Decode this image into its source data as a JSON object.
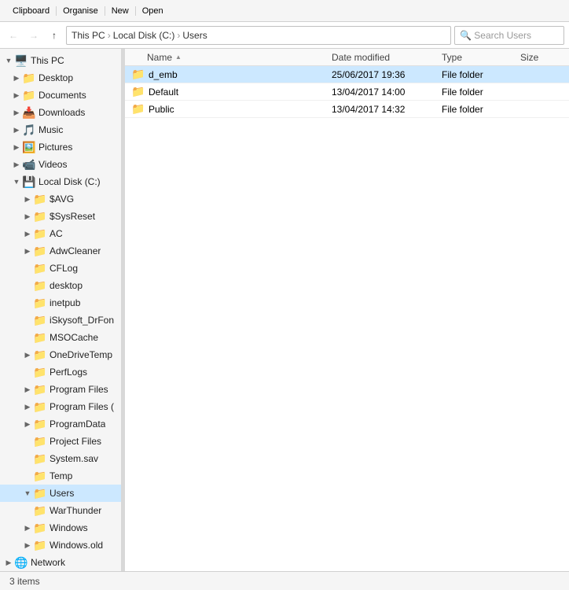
{
  "toolbar": {
    "sections": [
      {
        "label": "Clipboard"
      },
      {
        "label": "Organise"
      },
      {
        "label": "New"
      },
      {
        "label": "Open"
      }
    ],
    "clipboard_label": "Clipboard",
    "organise_label": "Organise",
    "new_label": "New",
    "open_label": "Open"
  },
  "addressbar": {
    "back_label": "←",
    "forward_label": "→",
    "up_label": "↑",
    "breadcrumbs": [
      "This PC",
      "Local Disk (C:)",
      "Users"
    ],
    "search_placeholder": "Search Users"
  },
  "sidebar": {
    "items": [
      {
        "id": "this-pc",
        "label": "This PC",
        "icon": "🖥️",
        "indent": 0,
        "expanded": true,
        "expander": "▼"
      },
      {
        "id": "desktop",
        "label": "Desktop",
        "icon": "📁",
        "indent": 1,
        "expanded": false,
        "expander": "▶",
        "special": true
      },
      {
        "id": "documents",
        "label": "Documents",
        "icon": "📁",
        "indent": 1,
        "expanded": false,
        "expander": "▶",
        "special": true
      },
      {
        "id": "downloads",
        "label": "Downloads",
        "icon": "📁",
        "indent": 1,
        "expanded": false,
        "expander": "▶",
        "special": true,
        "highlight": true
      },
      {
        "id": "music",
        "label": "Music",
        "icon": "📁",
        "indent": 1,
        "expanded": false,
        "expander": "▶",
        "special": true
      },
      {
        "id": "pictures",
        "label": "Pictures",
        "icon": "📁",
        "indent": 1,
        "expanded": false,
        "expander": "▶",
        "special": true
      },
      {
        "id": "videos",
        "label": "Videos",
        "icon": "📁",
        "indent": 1,
        "expanded": false,
        "expander": "▶",
        "special": true
      },
      {
        "id": "local-disk-c",
        "label": "Local Disk (C:)",
        "icon": "💾",
        "indent": 1,
        "expanded": true,
        "expander": "▼"
      },
      {
        "id": "savg",
        "label": "$AVG",
        "icon": "📁",
        "indent": 2,
        "expanded": false,
        "expander": "▶"
      },
      {
        "id": "ssysreset",
        "label": "$SysReset",
        "icon": "📁",
        "indent": 2,
        "expanded": false,
        "expander": "▶"
      },
      {
        "id": "ac",
        "label": "AC",
        "icon": "📁",
        "indent": 2,
        "expanded": false,
        "expander": "▶"
      },
      {
        "id": "adwcleaner",
        "label": "AdwCleaner",
        "icon": "📁",
        "indent": 2,
        "expanded": false,
        "expander": "▶"
      },
      {
        "id": "cflog",
        "label": "CFLog",
        "icon": "📁",
        "indent": 2,
        "expanded": false,
        "expander": ""
      },
      {
        "id": "desktop2",
        "label": "desktop",
        "icon": "📁",
        "indent": 2,
        "expanded": false,
        "expander": ""
      },
      {
        "id": "inetpub",
        "label": "inetpub",
        "icon": "📁",
        "indent": 2,
        "expanded": false,
        "expander": ""
      },
      {
        "id": "iskysoft",
        "label": "iSkysoft_DrFon",
        "icon": "📁",
        "indent": 2,
        "expanded": false,
        "expander": ""
      },
      {
        "id": "msocache",
        "label": "MSOCache",
        "icon": "📁",
        "indent": 2,
        "expanded": false,
        "expander": ""
      },
      {
        "id": "onedrivetemp",
        "label": "OneDriveTemp",
        "icon": "📁",
        "indent": 2,
        "expanded": false,
        "expander": "▶"
      },
      {
        "id": "perflogs",
        "label": "PerfLogs",
        "icon": "📁",
        "indent": 2,
        "expanded": false,
        "expander": ""
      },
      {
        "id": "program-files",
        "label": "Program Files",
        "icon": "📁",
        "indent": 2,
        "expanded": false,
        "expander": "▶"
      },
      {
        "id": "program-files-x86",
        "label": "Program Files (",
        "icon": "📁",
        "indent": 2,
        "expanded": false,
        "expander": "▶"
      },
      {
        "id": "programdata",
        "label": "ProgramData",
        "icon": "📁",
        "indent": 2,
        "expanded": false,
        "expander": "▶"
      },
      {
        "id": "project-files",
        "label": "Project Files",
        "icon": "📁",
        "indent": 2,
        "expanded": false,
        "expander": ""
      },
      {
        "id": "system-sav",
        "label": "System.sav",
        "icon": "📁",
        "indent": 2,
        "expanded": false,
        "expander": ""
      },
      {
        "id": "temp",
        "label": "Temp",
        "icon": "📁",
        "indent": 2,
        "expanded": false,
        "expander": ""
      },
      {
        "id": "users",
        "label": "Users",
        "icon": "📁",
        "indent": 2,
        "expanded": true,
        "expander": "▼",
        "selected": true
      },
      {
        "id": "warthunder",
        "label": "WarThunder",
        "icon": "📁",
        "indent": 2,
        "expanded": false,
        "expander": ""
      },
      {
        "id": "windows",
        "label": "Windows",
        "icon": "📁",
        "indent": 2,
        "expanded": false,
        "expander": "▶"
      },
      {
        "id": "windows-old",
        "label": "Windows.old",
        "icon": "📁",
        "indent": 2,
        "expanded": false,
        "expander": "▶"
      },
      {
        "id": "network",
        "label": "Network",
        "icon": "🌐",
        "indent": 0,
        "expanded": false,
        "expander": "▶"
      }
    ]
  },
  "content": {
    "columns": {
      "name": "Name",
      "date_modified": "Date modified",
      "type": "Type",
      "size": "Size"
    },
    "files": [
      {
        "name": "d_emb",
        "date": "25/06/2017 19:36",
        "type": "File folder",
        "size": "",
        "selected": true
      },
      {
        "name": "Default",
        "date": "13/04/2017 14:00",
        "type": "File folder",
        "size": ""
      },
      {
        "name": "Public",
        "date": "13/04/2017 14:32",
        "type": "File folder",
        "size": ""
      }
    ]
  },
  "statusbar": {
    "text": "3 items"
  }
}
